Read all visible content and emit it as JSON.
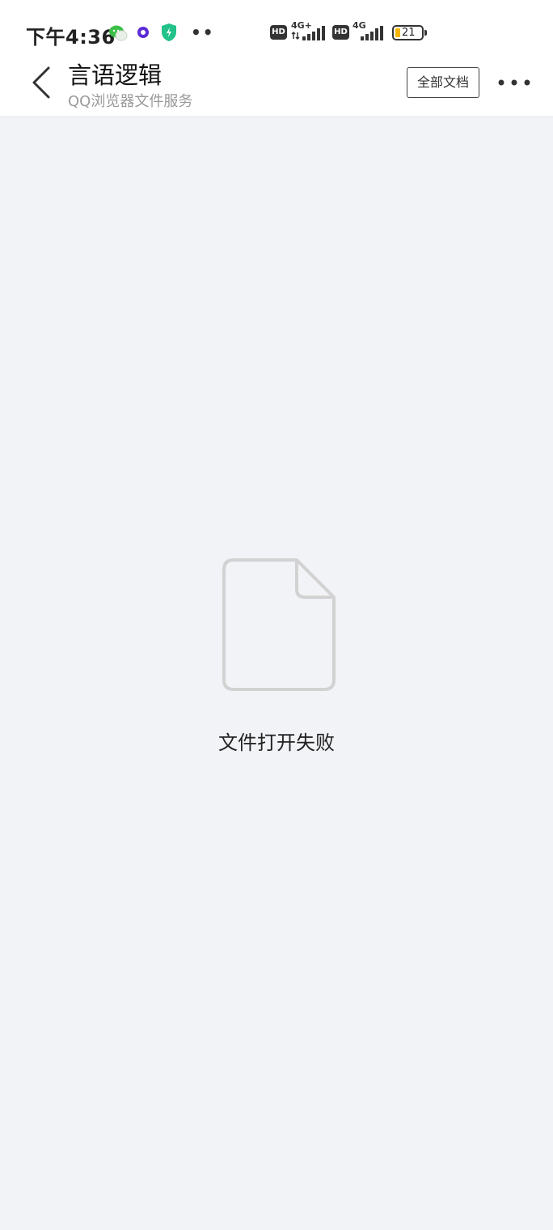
{
  "status_bar": {
    "time": "下午4:36",
    "network_1": "4G+",
    "network_2": "4G",
    "hd_label": "HD",
    "battery": "21",
    "icons": [
      "wechat-icon",
      "app-notification-icon",
      "security-shield-icon",
      "more-notifications-icon"
    ]
  },
  "nav": {
    "title": "言语逻辑",
    "subtitle": "QQ浏览器文件服务",
    "all_docs_label": "全部文档",
    "back_icon": "chevron-left-icon",
    "more_icon": "more-dots-icon"
  },
  "content": {
    "icon": "file-icon",
    "error_message": "文件打开失败"
  },
  "colors": {
    "background": "#f2f3f7",
    "header": "#ffffff",
    "battery_fill": "#f5b400",
    "shield": "#22c28a",
    "wechat": "#3cc04a",
    "app_icon": "#5b2bd6"
  }
}
